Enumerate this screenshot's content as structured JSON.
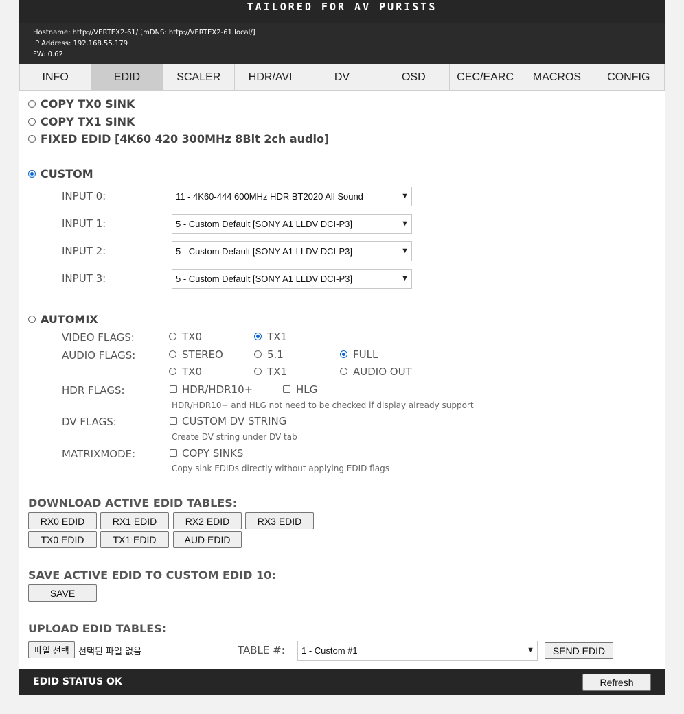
{
  "header": {
    "tagline": "TAILORED FOR AV PURISTS",
    "hostname": "Hostname: http://VERTEX2-61/ [mDNS: http://VERTEX2-61.local/]",
    "ip": "IP Address: 192.168.55.179",
    "fw": "FW: 0.62"
  },
  "tabs": [
    "INFO",
    "EDID",
    "SCALER",
    "HDR/AVI",
    "DV",
    "OSD",
    "CEC/EARC",
    "MACROS",
    "CONFIG"
  ],
  "active_tab": "EDID",
  "modes": {
    "copy_tx0": "COPY TX0 SINK",
    "copy_tx1": "COPY TX1 SINK",
    "fixed": "FIXED EDID [4K60 420 300MHz 8Bit 2ch audio]",
    "custom": "CUSTOM",
    "automix": "AUTOMIX",
    "selected": "CUSTOM"
  },
  "custom_inputs": [
    {
      "label": "INPUT 0:",
      "value": "11 - 4K60-444 600MHz HDR BT2020 All Sound"
    },
    {
      "label": "INPUT 1:",
      "value": "5 - Custom Default [SONY A1 LLDV DCI-P3]"
    },
    {
      "label": "INPUT 2:",
      "value": "5 - Custom Default [SONY A1 LLDV DCI-P3]"
    },
    {
      "label": "INPUT 3:",
      "value": "5 - Custom Default [SONY A1 LLDV DCI-P3]"
    }
  ],
  "automix": {
    "video_label": "VIDEO FLAGS:",
    "video_tx0": "TX0",
    "video_tx1": "TX1",
    "video_selected": "TX1",
    "audio_label": "AUDIO FLAGS:",
    "audio_stereo": "STEREO",
    "audio_51": "5.1",
    "audio_full": "FULL",
    "audio_selected": "FULL",
    "audio_tx0": "TX0",
    "audio_tx1": "TX1",
    "audio_out": "AUDIO OUT",
    "hdr_label": "HDR FLAGS:",
    "hdr_hdr10": "HDR/HDR10+",
    "hdr_hlg": "HLG",
    "hdr_hint": "HDR/HDR10+ and HLG not need to be checked if display already support",
    "dv_label": "DV FLAGS:",
    "dv_custom": "CUSTOM DV STRING",
    "dv_hint": "Create DV string under DV tab",
    "matrix_label": "MATRIXMODE:",
    "matrix_copy": "COPY SINKS",
    "matrix_hint": "Copy sink EDIDs directly without applying EDID flags"
  },
  "download": {
    "heading": "DOWNLOAD ACTIVE EDID TABLES:",
    "buttons": [
      "RX0 EDID",
      "RX1 EDID",
      "RX2 EDID",
      "RX3 EDID",
      "TX0 EDID",
      "TX1 EDID",
      "AUD EDID"
    ]
  },
  "save": {
    "heading": "SAVE ACTIVE EDID TO CUSTOM EDID 10:",
    "button": "SAVE"
  },
  "upload": {
    "heading": "UPLOAD EDID TABLES:",
    "file_button": "파일 선택",
    "file_status": "선택된 파일 없음",
    "table_label": "TABLE #:",
    "table_value": "1 - Custom #1",
    "send_button": "SEND EDID"
  },
  "footer": {
    "status": "EDID STATUS OK",
    "refresh": "Refresh"
  }
}
